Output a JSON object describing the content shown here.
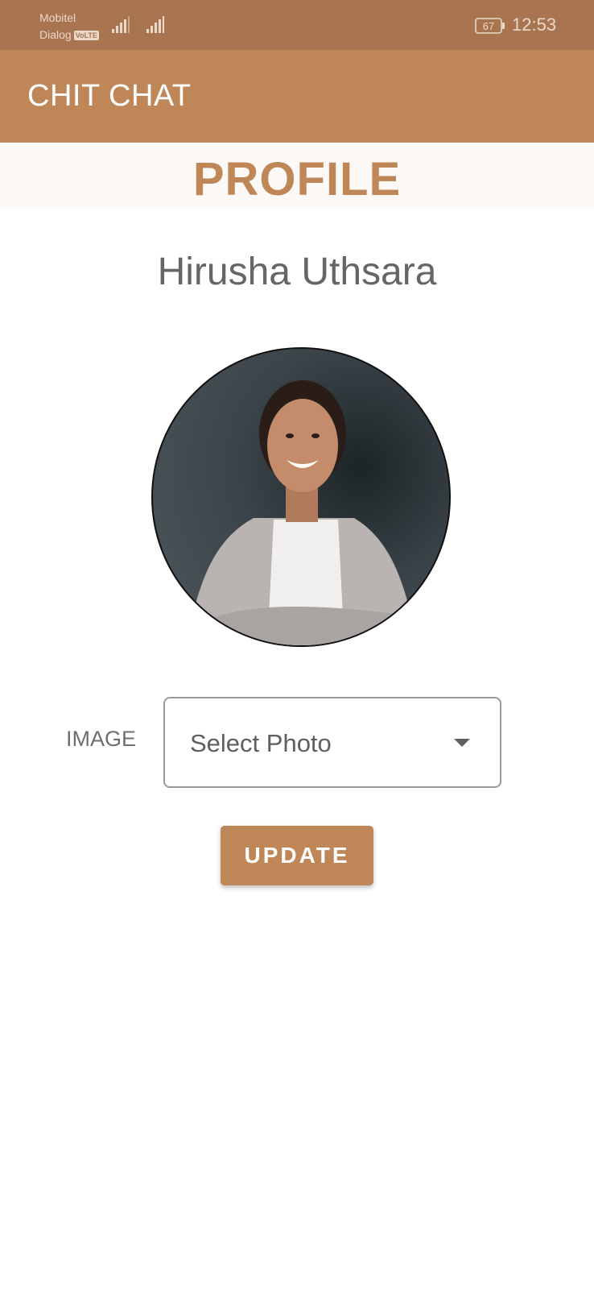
{
  "status_bar": {
    "carrier_1": "Mobitel",
    "carrier_2": "Dialog",
    "volte_badge": "VoLTE",
    "battery_level": "67",
    "time": "12:53",
    "icons": [
      "signal-icon",
      "signal-icon",
      "battery-icon"
    ]
  },
  "app_bar": {
    "title": "CHIT CHAT"
  },
  "profile": {
    "heading": "PROFILE",
    "name": "Hirusha Uthsara",
    "image_label": "IMAGE",
    "select_value": "Select Photo",
    "update_label": "UPDATE"
  },
  "colors": {
    "status_bar": "#a87550",
    "brand": "#bf8758",
    "band": "#fcf8f5",
    "text_gray": "#666666"
  }
}
